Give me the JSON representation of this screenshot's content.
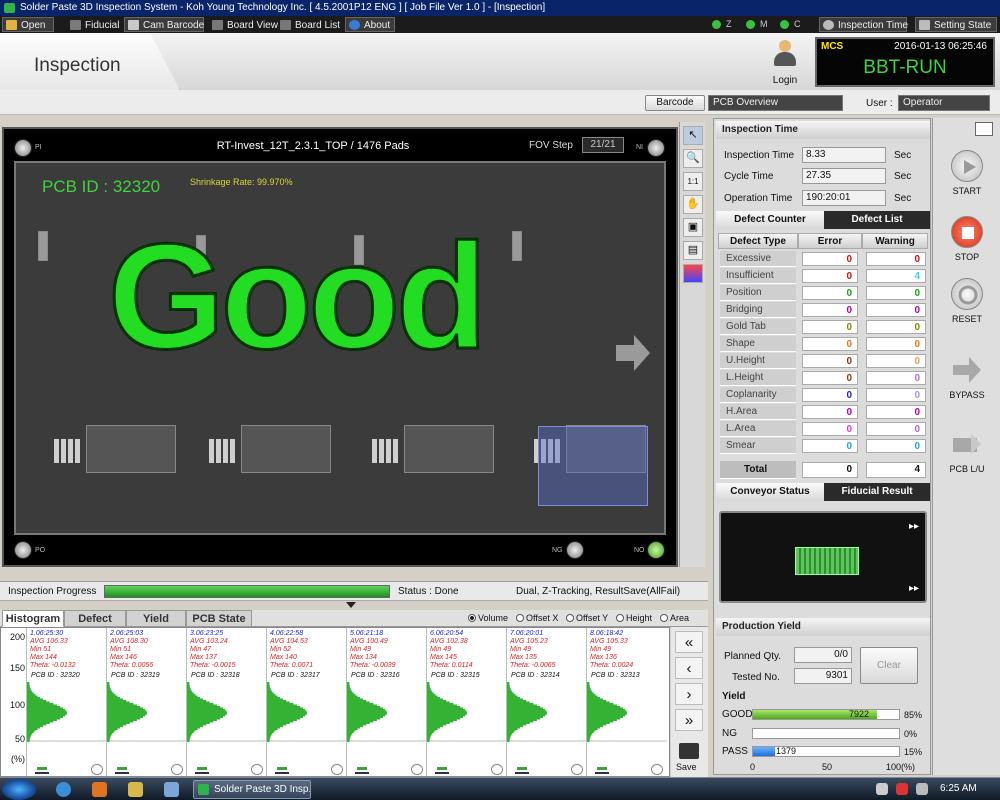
{
  "titlebar": {
    "text": "Solder Paste 3D Inspection System - Koh Young Technology Inc. [ 4.5.2001P12 ENG ] [ Job File Ver 1.0 ] - [Inspection]"
  },
  "menu": {
    "open": "Open",
    "fiducial": "Fiducial",
    "cam_barcode": "Cam Barcode",
    "board_view": "Board View",
    "board_list": "Board List",
    "about": "About",
    "modes": [
      "Z",
      "M",
      "C"
    ],
    "inspection_time": "Inspection Time",
    "setting_state": "Setting State"
  },
  "header": {
    "tab": "Inspection",
    "login": "Login",
    "mcs_label": "MCS",
    "datetime": "2016-01-13  06:25:46",
    "state": "BBT-RUN"
  },
  "barrow": {
    "barcode_btn": "Barcode",
    "barcode_value": "PCB Overview",
    "user_label": "User :",
    "user_value": "Operator"
  },
  "board": {
    "title": "RT-Invest_12T_2.3.1_TOP / 1476 Pads",
    "fov_label": "FOV Step",
    "fov_value": "21/21",
    "pcb_id": "PCB ID : 32320",
    "shrinkage": "Shrinkage Rate: 99.970%",
    "result": "Good",
    "corners": {
      "pi": "PI",
      "ni": "NI",
      "po": "PO",
      "ng": "NG",
      "no": "NO"
    }
  },
  "progress": {
    "label": "Inspection Progress",
    "fraction": 1.0,
    "status": "Status : Done",
    "mode": "Dual, Z-Tracking, ResultSave(AllFail)"
  },
  "hist_tabs": {
    "histogram": "Histogram",
    "defect": "Defect",
    "yield": "Yield",
    "pcb_state": "PCB State"
  },
  "hist_options": {
    "volume": "Volume",
    "offset_x": "Offset X",
    "offset_y": "Offset Y",
    "height": "Height",
    "area": "Area"
  },
  "hist_axis": {
    "y200": "200",
    "y150": "150",
    "y100": "100",
    "y50": "50",
    "unit": "(%)"
  },
  "histograms": [
    {
      "head": "1.06:25:30",
      "avg": "AVG 106.33",
      "min": "Min 51",
      "max": "Max 144",
      "theta": "Theta: -0.0132",
      "pcb": "PCB ID : 32320"
    },
    {
      "head": "2.06:25:03",
      "avg": "AVG 108.30",
      "min": "Min 51",
      "max": "Max 146",
      "theta": "Theta: 0.0056",
      "pcb": "PCB ID : 32319"
    },
    {
      "head": "3.06:23:25",
      "avg": "AVG 103.24",
      "min": "Min 47",
      "max": "Max 137",
      "theta": "Theta: -0.0015",
      "pcb": "PCB ID : 32318"
    },
    {
      "head": "4.06:22:58",
      "avg": "AVG 104.53",
      "min": "Min 52",
      "max": "Max 140",
      "theta": "Theta: 0.0071",
      "pcb": "PCB ID : 32317"
    },
    {
      "head": "5.06:21:18",
      "avg": "AVG 100.49",
      "min": "Min 49",
      "max": "Max 134",
      "theta": "Theta: -0.0039",
      "pcb": "PCB ID : 32316"
    },
    {
      "head": "6.06:20:54",
      "avg": "AVG 102.38",
      "min": "Min 49",
      "max": "Max 145",
      "theta": "Theta: 0.0114",
      "pcb": "PCB ID : 32315"
    },
    {
      "head": "7.06:20:01",
      "avg": "AVG 105.23",
      "min": "Min 49",
      "max": "Max 135",
      "theta": "Theta: -0.0065",
      "pcb": "PCB ID : 32314"
    },
    {
      "head": "8.06:18:42",
      "avg": "AVG 105.33",
      "min": "Min 49",
      "max": "Max 136",
      "theta": "Theta: 0.0024",
      "pcb": "PCB ID : 32313"
    }
  ],
  "hist_nav": {
    "first": "«",
    "prev": "‹",
    "next": "›",
    "last": "»",
    "save": "Save"
  },
  "inspection_time": {
    "head": "Inspection Time",
    "rows": [
      {
        "label": "Inspection Time",
        "value": "8.33",
        "unit": "Sec"
      },
      {
        "label": "Cycle Time",
        "value": "27.35",
        "unit": "Sec"
      },
      {
        "label": "Operation Time",
        "value": "190:20:01",
        "unit": "Sec"
      }
    ]
  },
  "defect": {
    "tab_counter": "Defect Counter",
    "tab_list": "Defect List",
    "col_type": "Defect Type",
    "col_error": "Error",
    "col_warning": "Warning",
    "rows": [
      {
        "name": "Excessive",
        "error": "0",
        "warning": "0",
        "ecolor": "#d01010",
        "wcolor": "#d01010"
      },
      {
        "name": "Insufficient",
        "error": "0",
        "warning": "4",
        "ecolor": "#d01010",
        "wcolor": "#3ad2e8"
      },
      {
        "name": "Position",
        "error": "0",
        "warning": "0",
        "ecolor": "#1aa81a",
        "wcolor": "#1aa81a"
      },
      {
        "name": "Bridging",
        "error": "0",
        "warning": "0",
        "ecolor": "#b000b0",
        "wcolor": "#b000b0"
      },
      {
        "name": "Gold Tab",
        "error": "0",
        "warning": "0",
        "ecolor": "#888800",
        "wcolor": "#888800"
      },
      {
        "name": "Shape",
        "error": "0",
        "warning": "0",
        "ecolor": "#e07a10",
        "wcolor": "#e07a10"
      },
      {
        "name": "U.Height",
        "error": "0",
        "warning": "0",
        "ecolor": "#8a3a1a",
        "wcolor": "#e0a060"
      },
      {
        "name": "L.Height",
        "error": "0",
        "warning": "0",
        "ecolor": "#8a3a1a",
        "wcolor": "#b06ad8"
      },
      {
        "name": "Coplanarity",
        "error": "0",
        "warning": "0",
        "ecolor": "#2020c8",
        "wcolor": "#9a9ae8"
      },
      {
        "name": "H.Area",
        "error": "0",
        "warning": "0",
        "ecolor": "#b000b0",
        "wcolor": "#b000b0"
      },
      {
        "name": "L.Area",
        "error": "0",
        "warning": "0",
        "ecolor": "#e03ae0",
        "wcolor": "#b06ad8"
      },
      {
        "name": "Smear",
        "error": "0",
        "warning": "0",
        "ecolor": "#20a8d8",
        "wcolor": "#20a8d8"
      }
    ],
    "total_label": "Total",
    "total_error": "0",
    "total_warning": "4"
  },
  "conveyor": {
    "tab_status": "Conveyor Status",
    "tab_fiducial": "Fiducial Result"
  },
  "production": {
    "head": "Production Yield",
    "planned_label": "Planned Qty.",
    "planned_value": "0/0",
    "tested_label": "Tested No.",
    "tested_value": "9301",
    "clear_btn": "Clear",
    "yield_head": "Yield",
    "good_label": "GOOD",
    "good_count": "7922",
    "good_pct": "85%",
    "good_fraction": 0.85,
    "ng_label": "NG",
    "ng_pct": "0%",
    "pass_label": "PASS",
    "pass_count": "1379",
    "pass_pct": "15%",
    "pass_fraction": 0.15,
    "axis": [
      "0",
      "50",
      "100(%)"
    ]
  },
  "side": {
    "start": "START",
    "stop": "STOP",
    "reset": "RESET",
    "bypass": "BYPASS",
    "pcb_lu": "PCB L/U"
  },
  "taskbar": {
    "app": "Solder Paste 3D Insp...",
    "clock": "6:25 AM"
  },
  "colors": {
    "good_green": "#22dd22",
    "mcs_state": "#3fd33f",
    "stop_red": "#e03a2a"
  }
}
